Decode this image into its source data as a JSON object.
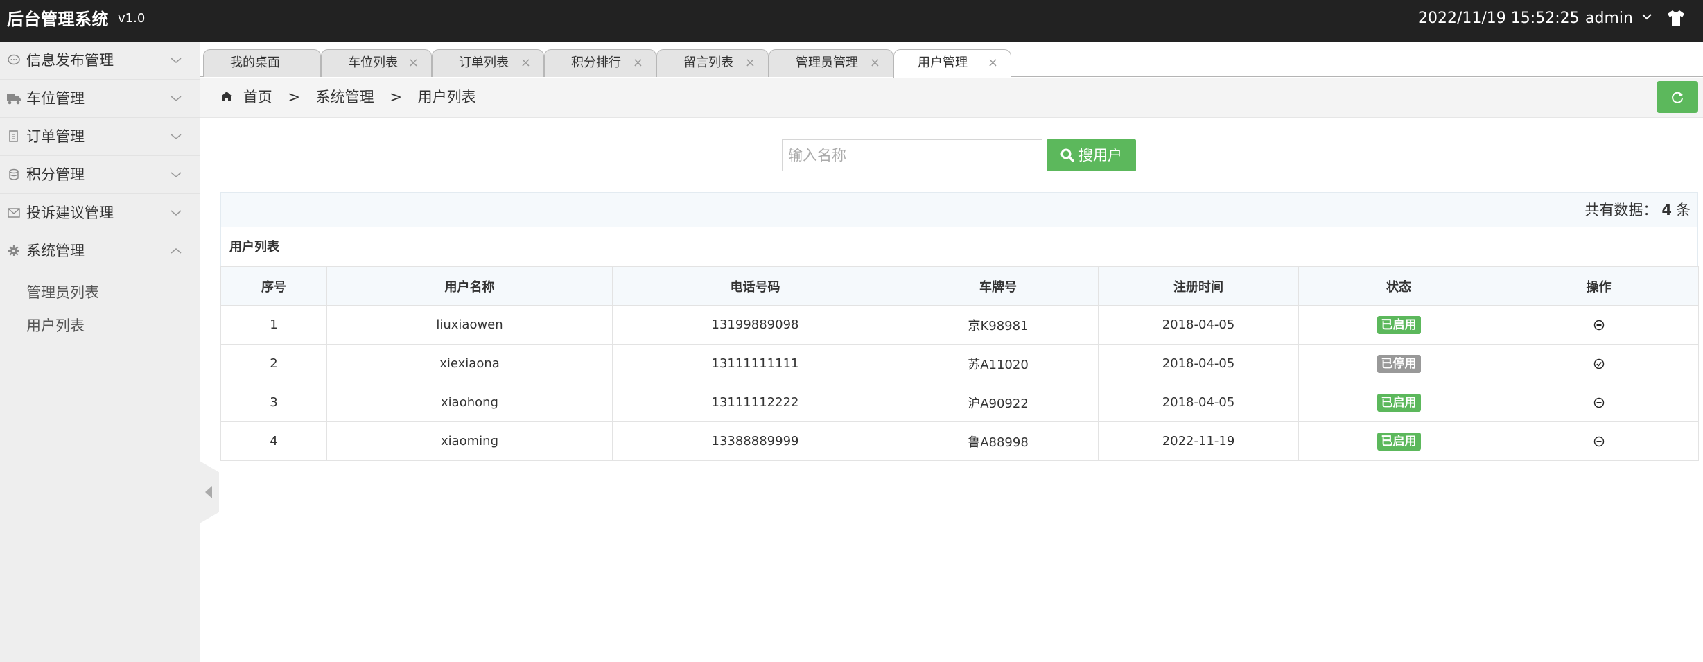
{
  "header": {
    "title": "后台管理系统",
    "version": "v1.0",
    "datetime": "2022/11/19 15:52:25",
    "user": "admin"
  },
  "sidebar": {
    "items": [
      {
        "label": "信息发布管理",
        "icon": "chat-icon"
      },
      {
        "label": "车位管理",
        "icon": "truck-icon"
      },
      {
        "label": "订单管理",
        "icon": "document-icon"
      },
      {
        "label": "积分管理",
        "icon": "database-icon"
      },
      {
        "label": "投诉建议管理",
        "icon": "envelope-icon"
      },
      {
        "label": "系统管理",
        "icon": "gear-icon"
      }
    ],
    "sub_items": [
      {
        "label": "管理员列表"
      },
      {
        "label": "用户列表"
      }
    ]
  },
  "tabs": [
    {
      "label": "我的桌面"
    },
    {
      "label": "车位列表"
    },
    {
      "label": "订单列表"
    },
    {
      "label": "积分排行"
    },
    {
      "label": "留言列表"
    },
    {
      "label": "管理员管理"
    },
    {
      "label": "用户管理"
    }
  ],
  "tab_close": "×",
  "breadcrumb": {
    "home": "首页",
    "sep": ">",
    "level1": "系统管理",
    "level2": "用户列表"
  },
  "search": {
    "placeholder": "输入名称",
    "button": "搜用户"
  },
  "count": {
    "prefix": "共有数据：",
    "value": "4",
    "suffix": "条"
  },
  "table": {
    "caption": "用户列表",
    "headers": [
      "序号",
      "用户名称",
      "电话号码",
      "车牌号",
      "注册时间",
      "状态",
      "操作"
    ],
    "rows": [
      {
        "no": "1",
        "name": "liuxiaowen",
        "phone": "13199889098",
        "plate": "京K98981",
        "date": "2018-04-05",
        "status": "已启用",
        "enabled": true
      },
      {
        "no": "2",
        "name": "xiexiaona",
        "phone": "13111111111",
        "plate": "苏A11020",
        "date": "2018-04-05",
        "status": "已停用",
        "enabled": false
      },
      {
        "no": "3",
        "name": "xiaohong",
        "phone": "13111112222",
        "plate": "沪A90922",
        "date": "2018-04-05",
        "status": "已启用",
        "enabled": true
      },
      {
        "no": "4",
        "name": "xiaoming",
        "phone": "13388889999",
        "plate": "鲁A88998",
        "date": "2022-11-19",
        "status": "已启用",
        "enabled": true
      }
    ]
  },
  "colors": {
    "header_bg": "#222222",
    "accent_green": "#5cb85c",
    "disabled_gray": "#999999"
  }
}
